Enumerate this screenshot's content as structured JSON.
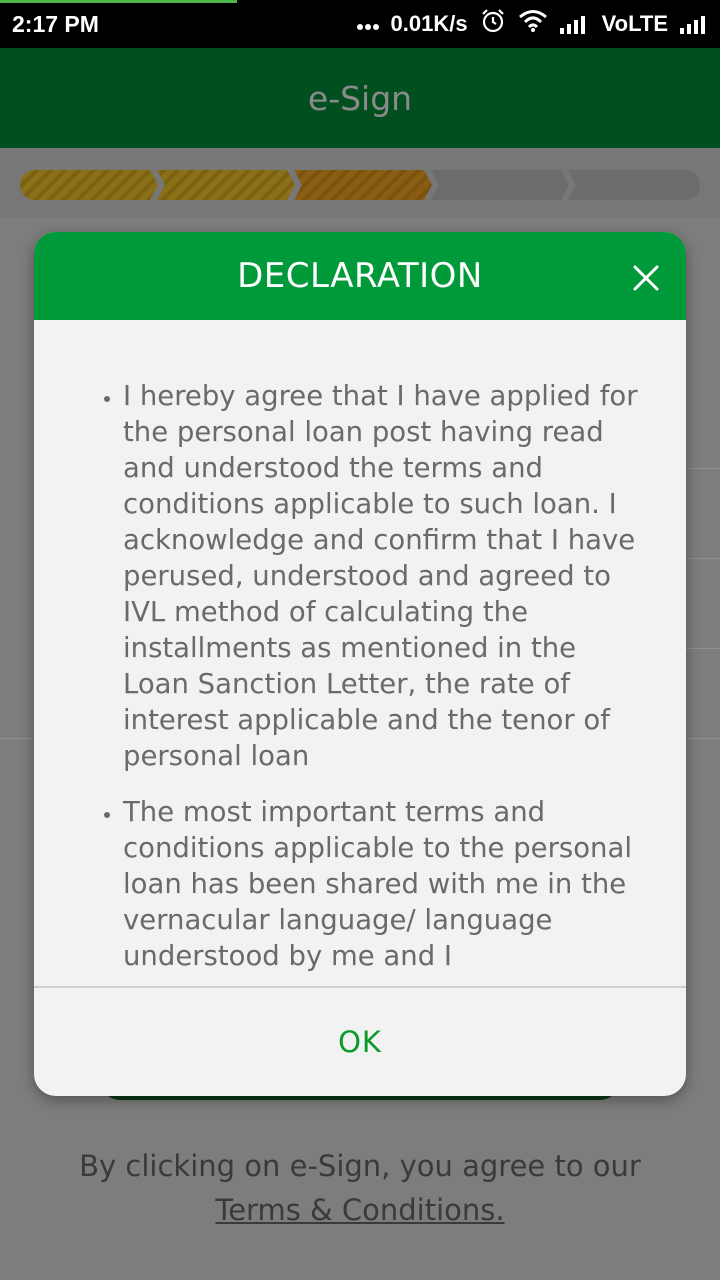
{
  "status_bar": {
    "time": "2:17 PM",
    "network_speed": "0.01K/s",
    "network_label": "VoLTE",
    "icons": [
      "more-dots-icon",
      "alarm-icon",
      "wifi-icon",
      "signal-icon",
      "signal-icon"
    ]
  },
  "header": {
    "title": "e-Sign"
  },
  "stepper": {
    "total_steps": 5,
    "completed_steps": 3,
    "colors": {
      "done": "#8a7016",
      "current": "#8a5e12",
      "pending": "#6c6c6c"
    }
  },
  "modal": {
    "title": "DECLARATION",
    "close_icon": "close-icon",
    "items": [
      "I hereby agree that I have applied for the personal loan post having read and understood the terms and conditions applicable to such loan. I acknowledge and confirm that I have perused, understood and agreed to IVL method of calculating the installments as mentioned in the Loan Sanction Letter, the rate of interest applicable and the tenor of personal loan",
      "The most important terms and conditions applicable to the personal loan has been shared with me in the vernacular language/ language understood by me and I"
    ],
    "ok_label": "OK"
  },
  "footer": {
    "text": "By clicking on e-Sign, you agree to our",
    "link": "Terms & Conditions."
  },
  "colors": {
    "header_bg": "#014f1e",
    "modal_header_bg": "#009a3a",
    "ok_text": "#0a9a2a"
  }
}
